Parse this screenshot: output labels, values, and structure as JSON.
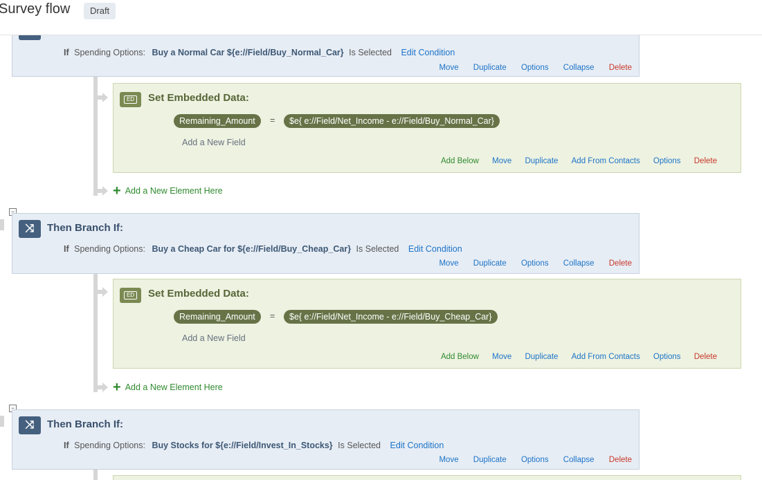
{
  "header": {
    "title": "Survey flow",
    "badge": "Draft"
  },
  "icons": {
    "branch": "shuffle-icon",
    "embedded_data": "ed-icon",
    "collapse": "minus-box-icon",
    "add": "plus-icon"
  },
  "colors": {
    "branch_bg": "#e7edf5",
    "ed_bg": "#eef2e1",
    "link": "#1b73c7",
    "delete": "#c8372a",
    "add": "#2f8a2f"
  },
  "branches": [
    {
      "title": "",
      "if_label": "If",
      "field": "Spending Options:",
      "choice": "Buy a Normal Car ${e://Field/Buy_Normal_Car}",
      "state": "Is Selected",
      "edit": "Edit Condition",
      "actions": [
        "Move",
        "Duplicate",
        "Options",
        "Collapse",
        "Delete"
      ],
      "embedded": {
        "title": "Set Embedded Data:",
        "field_name": "Remaining_Amount",
        "equals": "=",
        "value": "$e{ e://Field/Net_Income - e://Field/Buy_Normal_Car}",
        "add_field": "Add a New Field",
        "actions": [
          "Add Below",
          "Move",
          "Duplicate",
          "Add From Contacts",
          "Options",
          "Delete"
        ],
        "badge": "ED"
      },
      "add_element": "Add a New Element Here"
    },
    {
      "title": "Then Branch If:",
      "if_label": "If",
      "field": "Spending Options:",
      "choice": "Buy a Cheap Car for ${e://Field/Buy_Cheap_Car}",
      "state": "Is Selected",
      "edit": "Edit Condition",
      "actions": [
        "Move",
        "Duplicate",
        "Options",
        "Collapse",
        "Delete"
      ],
      "embedded": {
        "title": "Set Embedded Data:",
        "field_name": "Remaining_Amount",
        "equals": "=",
        "value": "$e{ e://Field/Net_Income - e://Field/Buy_Cheap_Car}",
        "add_field": "Add a New Field",
        "actions": [
          "Add Below",
          "Move",
          "Duplicate",
          "Add From Contacts",
          "Options",
          "Delete"
        ],
        "badge": "ED"
      },
      "add_element": "Add a New Element Here"
    },
    {
      "title": "Then Branch If:",
      "if_label": "If",
      "field": "Spending Options:",
      "choice": "Buy Stocks for ${e://Field/Invest_In_Stocks}",
      "state": "Is Selected",
      "edit": "Edit Condition",
      "actions": [
        "Move",
        "Duplicate",
        "Options",
        "Collapse",
        "Delete"
      ]
    }
  ]
}
